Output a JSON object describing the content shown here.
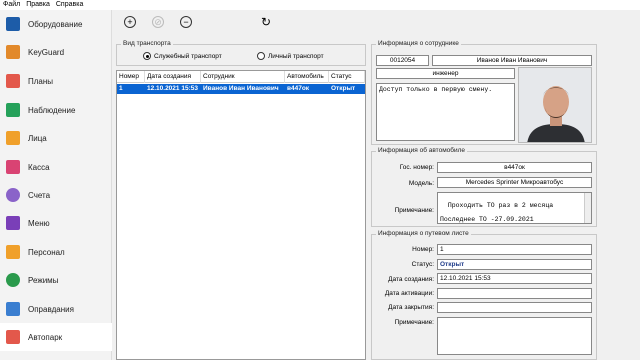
{
  "menu": [
    "Файл",
    "Правка",
    "Справка"
  ],
  "sidebar": {
    "items": [
      {
        "label": "Оборудование",
        "icon": "network-icon",
        "color": "#1d5ca8"
      },
      {
        "label": "KeyGuard",
        "icon": "folder-icon",
        "color": "#e2892a"
      },
      {
        "label": "Планы",
        "icon": "calendar-icon",
        "color": "#e3584b"
      },
      {
        "label": "Наблюдение",
        "icon": "camera-icon",
        "color": "#25a15a"
      },
      {
        "label": "Лица",
        "icon": "face-icon",
        "color": "#f0a02a"
      },
      {
        "label": "Касса",
        "icon": "cash-icon",
        "color": "#d94373"
      },
      {
        "label": "Счета",
        "icon": "invoice-icon",
        "color": "#8a63c9"
      },
      {
        "label": "Меню",
        "icon": "menu-icon",
        "color": "#7a3fb8"
      },
      {
        "label": "Персонал",
        "icon": "person-icon",
        "color": "#f0a02a"
      },
      {
        "label": "Режимы",
        "icon": "mode-icon",
        "color": "#2a9a4c"
      },
      {
        "label": "Оправдания",
        "icon": "document-icon",
        "color": "#3a7ed0"
      },
      {
        "label": "Автопарк",
        "icon": "car-icon",
        "color": "#e3584b"
      }
    ]
  },
  "toolbar": {
    "add": "+",
    "delete": "⊘",
    "remove": "−",
    "refresh": "↻"
  },
  "transport_type": {
    "title": "Вид транспорта",
    "option_service": "Служебный транспорт",
    "option_personal": "Личный транспорт"
  },
  "table": {
    "columns": [
      "Номер",
      "Дата создания",
      "Сотрудник",
      "Автомобиль",
      "Статус"
    ],
    "rows": [
      [
        "1",
        "12.10.2021 15:53",
        "Иванов Иван Иванович",
        "в447ок",
        "Открыт"
      ]
    ]
  },
  "employee": {
    "title": "Информация о сотруднике",
    "id": "0012054",
    "name": "Иванов Иван Иванович",
    "position": "инженер",
    "note": "Доступ только в первую смену."
  },
  "car": {
    "title": "Информация об автомобиле",
    "plate_label": "Гос. номер:",
    "plate": "в447ок",
    "model_label": "Модель:",
    "model": "Mercedes Sprinter Микроавтобус",
    "note_label": "Примечание:",
    "note": "Проходить ТО раз в 2 месяца\n\nПоследнее ТО -27.09.2021"
  },
  "waybill": {
    "title": "Информация о путевом листе",
    "number_label": "Номер:",
    "number": "1",
    "status_label": "Статус:",
    "status": "Открыт",
    "created_label": "Дата создания:",
    "created": "12.10.2021 15:53",
    "activated_label": "Дата активации:",
    "activated": "",
    "closed_label": "Дата закрытия:",
    "closed": "",
    "note_label": "Примечание:",
    "note": ""
  }
}
